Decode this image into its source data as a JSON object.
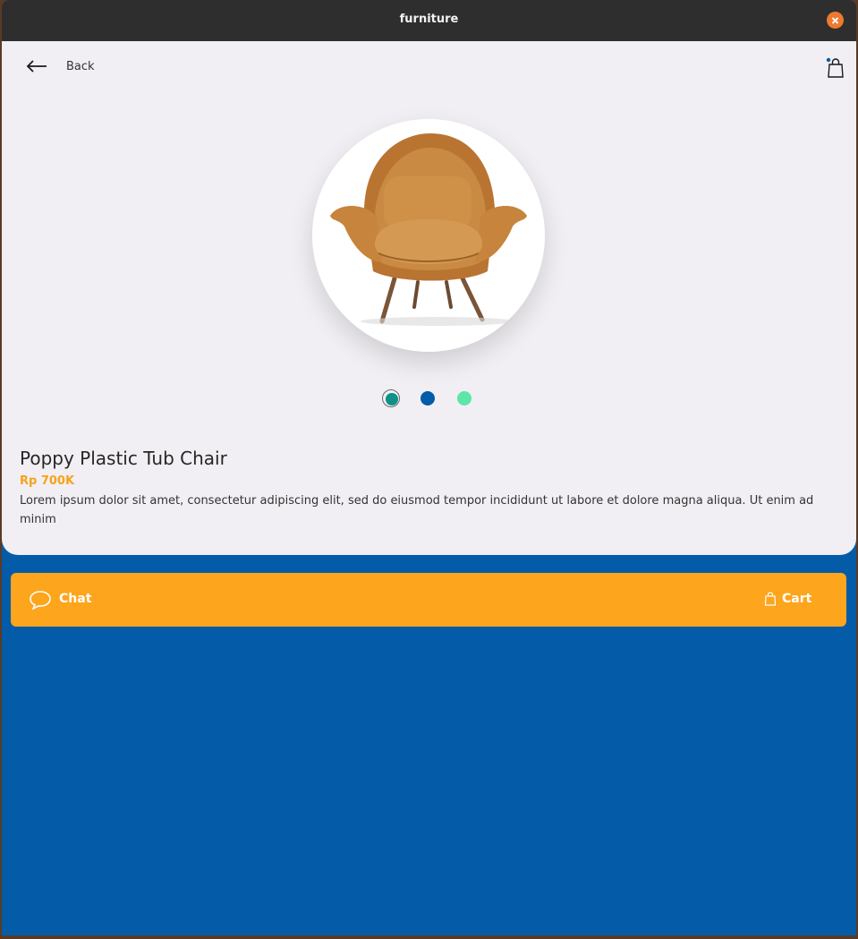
{
  "window": {
    "title": "furniture"
  },
  "header": {
    "back_label": "Back"
  },
  "product": {
    "name": "Poppy Plastic Tub Chair",
    "price": "Rp 700K",
    "description": "Lorem ipsum dolor sit amet, consectetur adipiscing elit, sed do eiusmod tempor incididunt ut labore et dolore magna aliqua. Ut enim ad minim",
    "image_icon": "armchair-image",
    "colors": [
      {
        "hex": "#0e9187",
        "selected": true
      },
      {
        "hex": "#045ca8",
        "selected": false
      },
      {
        "hex": "#5ee6a8",
        "selected": false
      }
    ]
  },
  "actions": {
    "chat_label": "Chat",
    "cart_label": "Cart"
  },
  "theme": {
    "accent": "#fda51c",
    "background": "#045ca8",
    "card": "#f1eff3",
    "price_color": "#f7a21b"
  }
}
